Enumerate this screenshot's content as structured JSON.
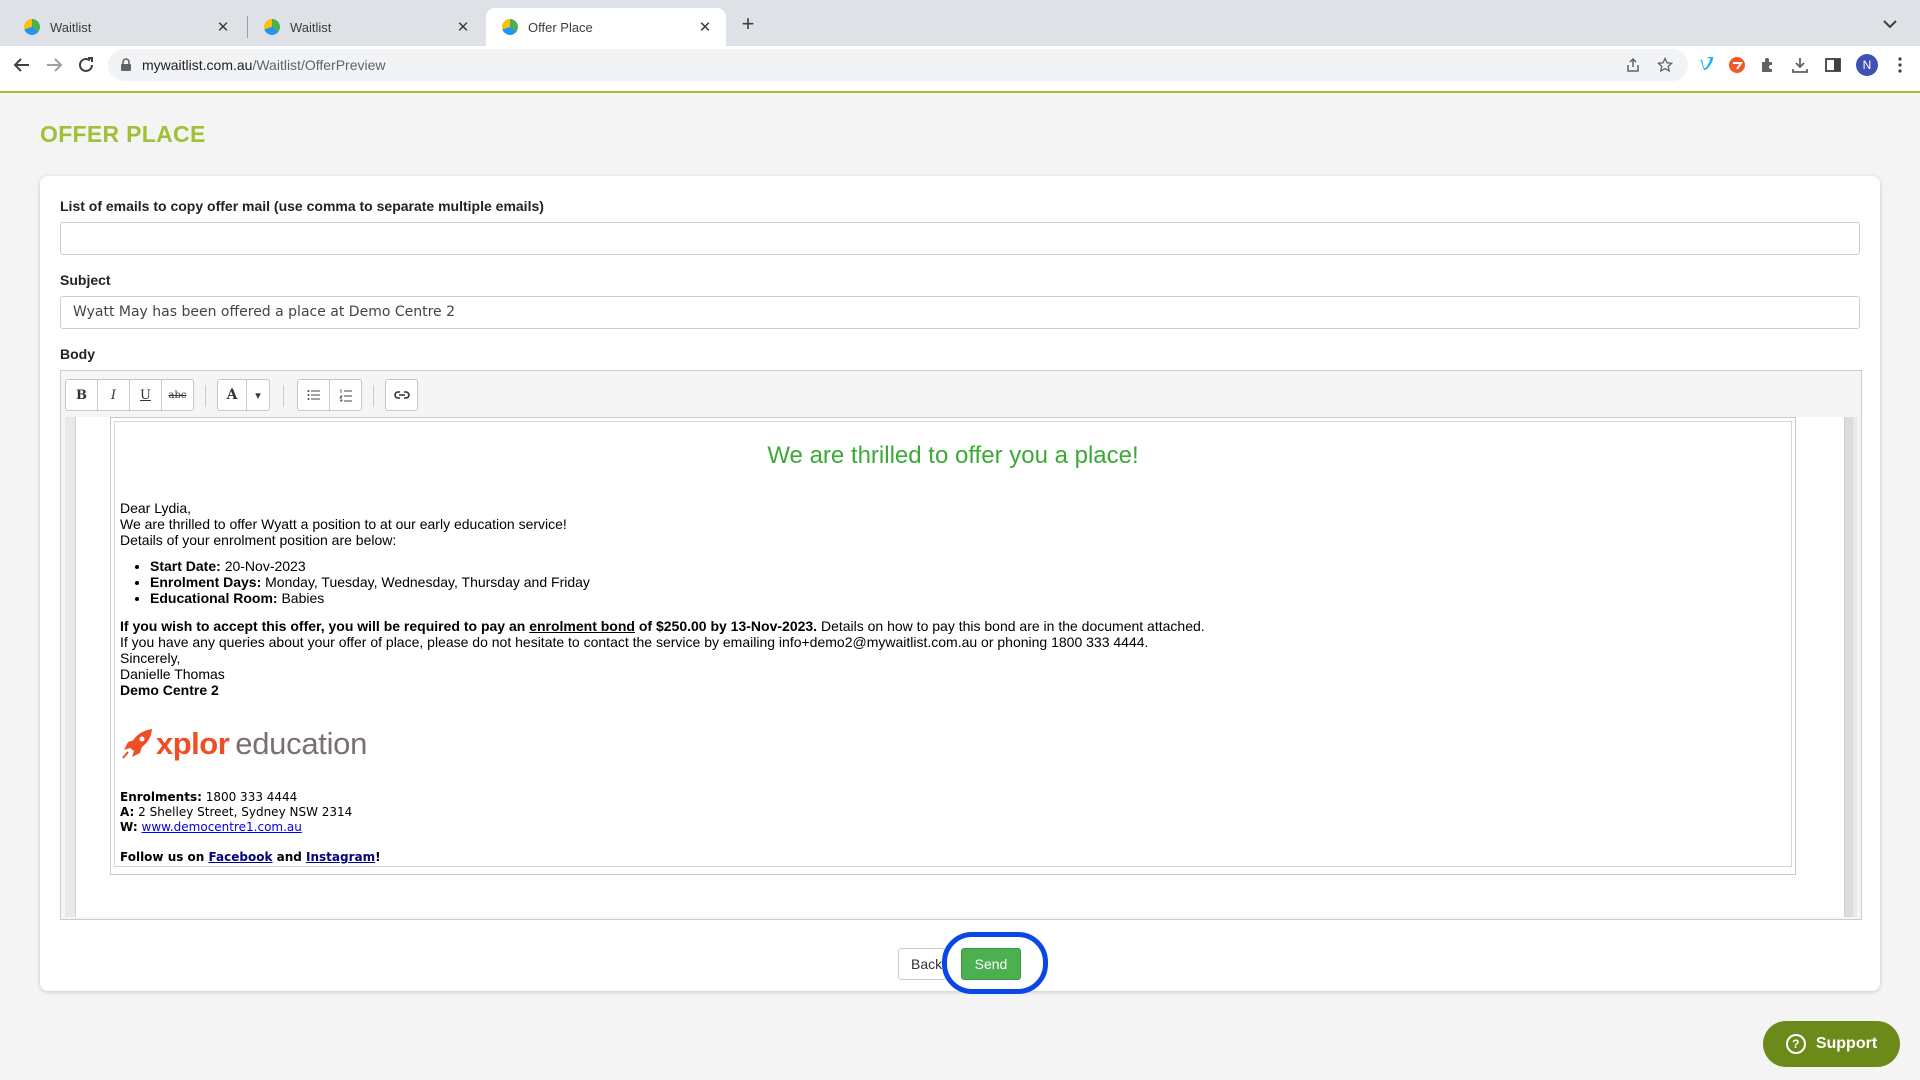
{
  "browser": {
    "tabs": [
      {
        "title": "Waitlist",
        "active": false
      },
      {
        "title": "Waitlist",
        "active": false
      },
      {
        "title": "Offer Place",
        "active": true
      }
    ],
    "url_host": "mywaitlist.com.au",
    "url_path": "/Waitlist/OfferPreview",
    "new_tab_glyph": "+",
    "profile_initial": "N"
  },
  "page": {
    "title": "OFFER PLACE",
    "cc_label": "List of emails to copy offer mail (use comma to separate multiple emails)",
    "cc_value": "",
    "subject_label": "Subject",
    "subject_value": "Wyatt May has been offered a place at Demo Centre 2",
    "body_label": "Body"
  },
  "editor_toolbar": {
    "bold": "B",
    "italic": "I",
    "underline": "U",
    "strike": "abc",
    "font_color": "A",
    "dropdown": "▾"
  },
  "email": {
    "heading": "We are thrilled to offer you a place!",
    "greeting": "Dear Lydia,",
    "line1": "We are thrilled to offer Wyatt a position to  at our early education service!",
    "line2": "Details of your enrolment position are below:",
    "details": [
      {
        "label": "Start Date:",
        "value": "20-Nov-2023"
      },
      {
        "label": "Enrolment Days:",
        "value": "Monday, Tuesday, Wednesday, Thursday and Friday"
      },
      {
        "label": "Educational Room:",
        "value": "Babies"
      }
    ],
    "accept_pre": "If you wish to accept this offer, you will be required to pay an ",
    "accept_bond": "enrolment bond",
    "accept_post": " of $250.00 by 13-Nov-2023.",
    "accept_tail": " Details on how to pay this bond are in the document attached.",
    "queries": "If you have any queries about your offer of place, please do not hesitate to contact the service by emailing info+demo2@mywaitlist.com.au or phoning 1800 333 4444.",
    "sincerely": "Sincerely,",
    "sender": "Danielle Thomas",
    "centre": "Demo Centre 2",
    "logo_brand": "xplor",
    "logo_word": "education",
    "enrolments_label": "Enrolments:",
    "enrolments_value": " 1800 333 4444",
    "address_label": "A:",
    "address_value": " 2 Shelley Street, Sydney NSW 2314",
    "web_label": "W:",
    "web_link": "www.democentre1.com.au",
    "follow_pre": "Follow us on ",
    "facebook": "Facebook",
    "follow_mid": " and ",
    "instagram": "Instagram",
    "follow_post": "!"
  },
  "actions": {
    "back_label": "Back",
    "send_label": "Send"
  },
  "support": {
    "label": "Support",
    "glyph": "?"
  },
  "colors": {
    "brand_green": "#a2c037",
    "send_green": "#4caf50",
    "heading_green": "#3aaa35",
    "highlight_blue": "#0a48e6",
    "support_green": "#6c8a1a",
    "xplor_orange": "#f04e23"
  },
  "icons": {
    "back": "arrow-left-icon",
    "forward": "arrow-right-icon",
    "reload": "reload-icon",
    "lock": "lock-icon",
    "share": "share-icon",
    "star": "star-icon",
    "extensions": "puzzle-icon",
    "download": "download-icon",
    "sidepanel": "side-panel-icon"
  }
}
